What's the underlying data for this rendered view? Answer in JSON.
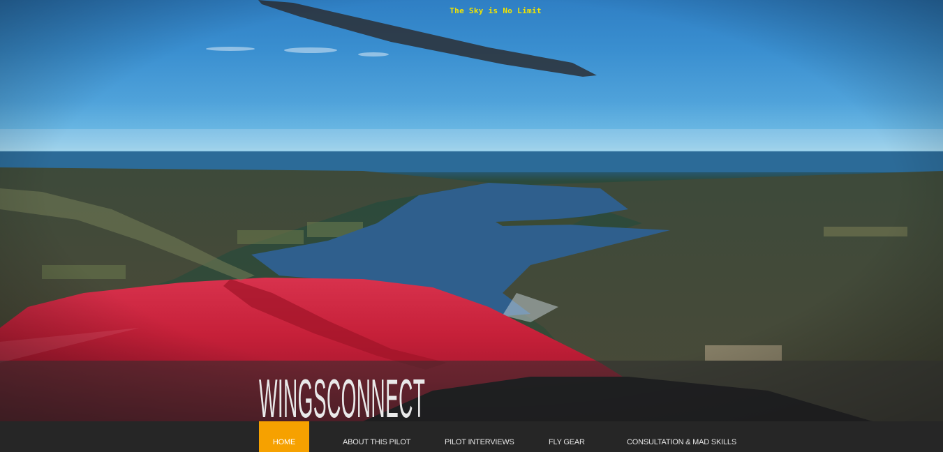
{
  "header": {
    "tagline": "The Sky is No Limit",
    "site_name": "WINGSCONNECT"
  },
  "nav": {
    "items": [
      {
        "label": "HOME",
        "active": true
      },
      {
        "label": "ABOUT THIS PILOT",
        "active": false
      },
      {
        "label": "PILOT INTERVIEWS",
        "active": false
      },
      {
        "label": "FLY GEAR",
        "active": false
      },
      {
        "label": "CONSULTATION & MAD SKILLS",
        "active": false
      }
    ]
  },
  "colors": {
    "accent": "#f6a100",
    "tagline": "#f2e400",
    "nav_background": "#262626",
    "wing": "#c8203a"
  }
}
